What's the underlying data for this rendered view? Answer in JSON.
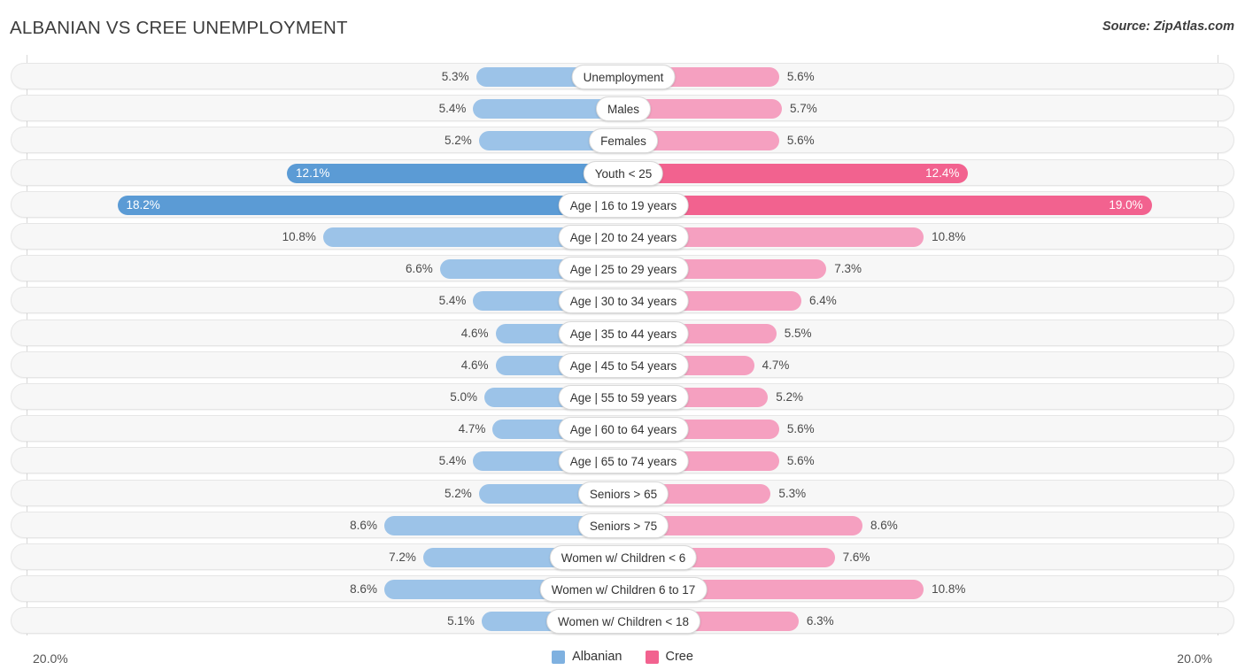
{
  "header": {
    "title": "ALBANIAN VS CREE UNEMPLOYMENT",
    "source": "Source: ZipAtlas.com"
  },
  "legend": {
    "items": [
      {
        "label": "Albanian",
        "color": "#7FB1E0"
      },
      {
        "label": "Cree",
        "color": "#F2628F"
      }
    ]
  },
  "axis": {
    "left_max_label": "20.0%",
    "right_max_label": "20.0%",
    "max_value": 20.0
  },
  "colors": {
    "albanian_light": "#9CC3E8",
    "albanian_dark": "#5B9BD5",
    "cree_light": "#F5A0C0",
    "cree_dark": "#F2628F",
    "row_track": "#f7f7f7",
    "row_border": "#e6e6e6"
  },
  "chart_data": {
    "type": "bar",
    "subtype": "diverging-bar",
    "title": "ALBANIAN VS CREE UNEMPLOYMENT",
    "xlabel": "",
    "ylabel": "",
    "xlim": [
      -20.0,
      20.0
    ],
    "grid": false,
    "legend_position": "bottom-center",
    "axis_max_label": "20.0%",
    "categories": [
      "Unemployment",
      "Males",
      "Females",
      "Youth < 25",
      "Age | 16 to 19 years",
      "Age | 20 to 24 years",
      "Age | 25 to 29 years",
      "Age | 30 to 34 years",
      "Age | 35 to 44 years",
      "Age | 45 to 54 years",
      "Age | 55 to 59 years",
      "Age | 60 to 64 years",
      "Age | 65 to 74 years",
      "Seniors > 65",
      "Seniors > 75",
      "Women w/ Children < 6",
      "Women w/ Children 6 to 17",
      "Women w/ Children < 18"
    ],
    "series": [
      {
        "name": "Albanian",
        "side": "left",
        "values": [
          5.3,
          5.4,
          5.2,
          12.1,
          18.2,
          10.8,
          6.6,
          5.4,
          4.6,
          4.6,
          5.0,
          4.7,
          5.4,
          5.2,
          8.6,
          7.2,
          8.6,
          5.1
        ],
        "labels": [
          "5.3%",
          "5.4%",
          "5.2%",
          "12.1%",
          "18.2%",
          "10.8%",
          "6.6%",
          "5.4%",
          "4.6%",
          "4.6%",
          "5.0%",
          "4.7%",
          "5.4%",
          "5.2%",
          "8.6%",
          "7.2%",
          "8.6%",
          "5.1%"
        ]
      },
      {
        "name": "Cree",
        "side": "right",
        "values": [
          5.6,
          5.7,
          5.6,
          12.4,
          19.0,
          10.8,
          7.3,
          6.4,
          5.5,
          4.7,
          5.2,
          5.6,
          5.6,
          5.3,
          8.6,
          7.6,
          10.8,
          6.3
        ],
        "labels": [
          "5.6%",
          "5.7%",
          "5.6%",
          "12.4%",
          "19.0%",
          "10.8%",
          "7.3%",
          "6.4%",
          "5.5%",
          "4.7%",
          "5.2%",
          "5.6%",
          "5.6%",
          "5.3%",
          "8.6%",
          "7.6%",
          "10.8%",
          "6.3%"
        ]
      }
    ]
  }
}
